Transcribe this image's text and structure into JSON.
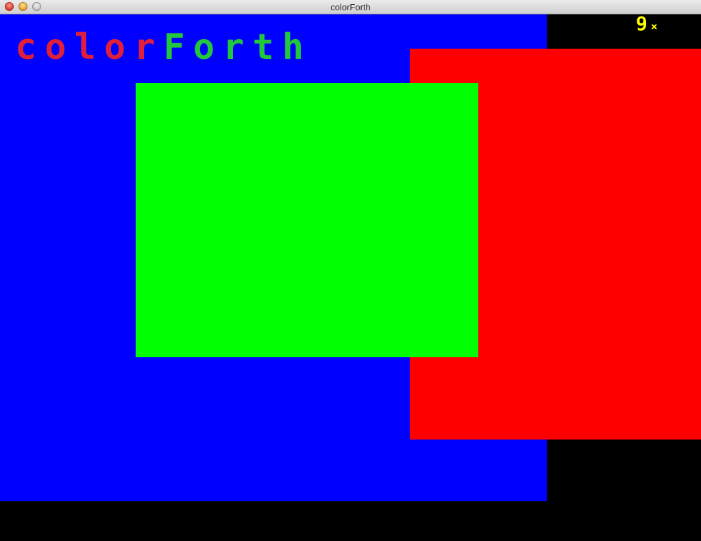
{
  "window": {
    "title": "colorForth"
  },
  "logo": {
    "part1": "color",
    "part2": "Forth",
    "part1_color": "#e0203a",
    "part2_color": "#22c83c"
  },
  "status": {
    "count": "9",
    "mark": "×",
    "color": "#ffff00"
  },
  "rectangles": [
    {
      "name": "blue",
      "color": "#0000ff"
    },
    {
      "name": "red",
      "color": "#ff0000"
    },
    {
      "name": "green",
      "color": "#00ff00"
    }
  ],
  "background_color": "#000000"
}
